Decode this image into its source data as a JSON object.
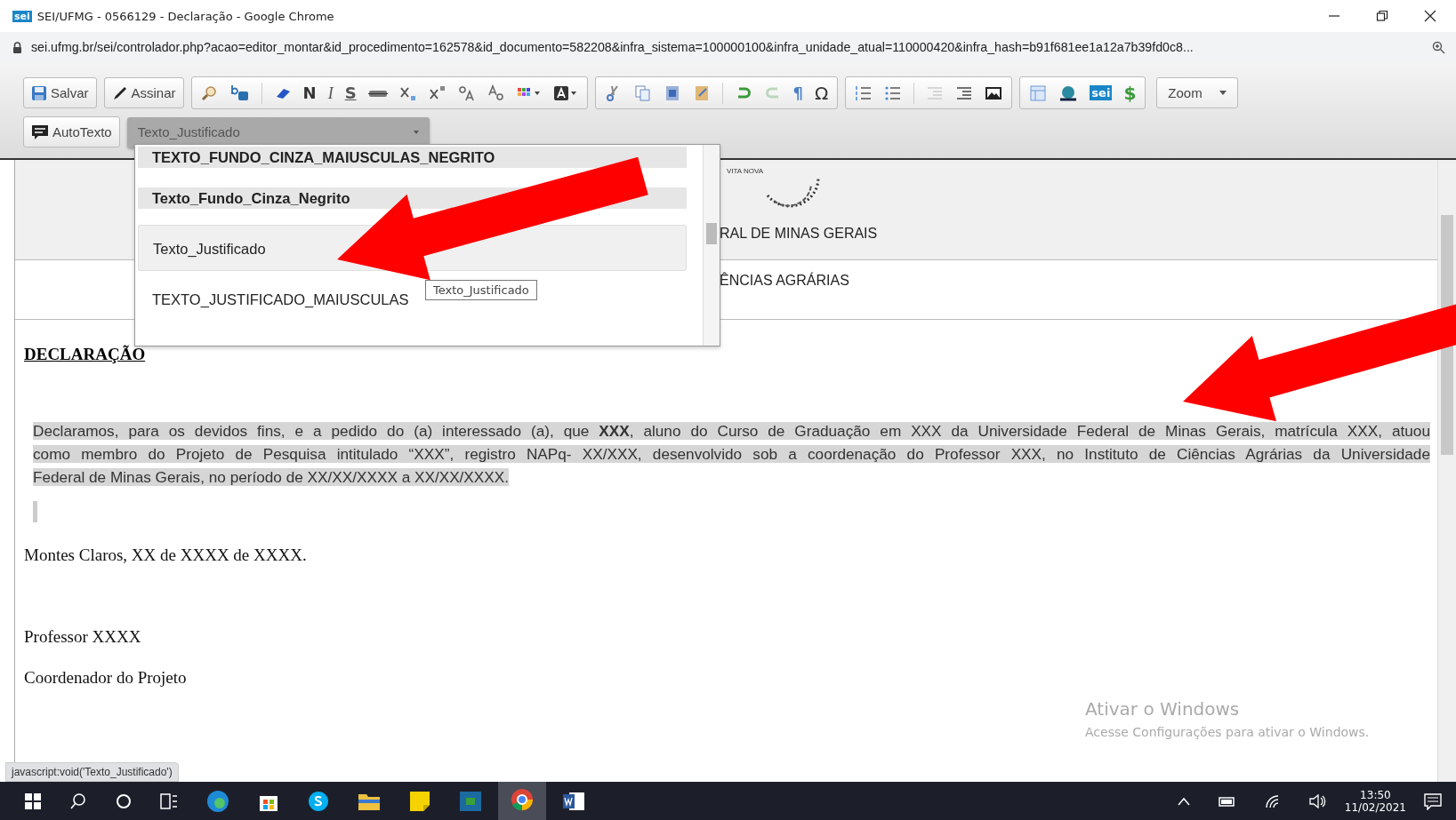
{
  "window": {
    "title": "SEI/UFMG - 0566129 - Declaração - Google Chrome",
    "logo": "sei"
  },
  "address_bar": {
    "url": "sei.ufmg.br/sei/controlador.php?acao=editor_montar&id_procedimento=162578&id_documento=582208&infra_sistema=100000100&infra_unidade_atual=110000420&infra_hash=b91f681ee1a12a7b39fd0c8..."
  },
  "toolbar": {
    "save_button": "Salvar",
    "sign_button": "Assinar",
    "bold": "N",
    "italic": "I",
    "strike": "S",
    "pilcrow": "¶",
    "omega": "Ω",
    "sei_logo": "sei",
    "dollar": "$",
    "zoom": "Zoom",
    "autotext_button": "AutoTexto",
    "style_select": "Texto_Justificado"
  },
  "style_dropdown": {
    "items": [
      {
        "label": "TEXTO_FUNDO_CINZA_MAIUSCULAS_NEGRITO",
        "kind": "bold-gray",
        "selected": false
      },
      {
        "label": "Texto_Fundo_Cinza_Negrito",
        "kind": "bold-gray",
        "selected": false
      },
      {
        "label": "Texto_Justificado",
        "kind": "plain",
        "selected": true
      },
      {
        "label": "TEXTO_JUSTIFICADO_MAIUSCULAS",
        "kind": "plain",
        "selected": false
      }
    ],
    "tooltip": "Texto_Justificado"
  },
  "document": {
    "seal_text": "VITA NOVA",
    "header_line_1": "RAL DE MINAS GERAIS",
    "header_line_2": "ÊNCIAS AGRÁRIAS",
    "title": "DECLARAÇÃO",
    "paragraph_lines": [
      "Declaramos, para os devidos fins, e a pedido do (a) interessado (a), que **XXX**, aluno do Curso de Graduação em XXX da Universidade Federal de Minas Gerais, matrícula XXX, atuou",
      "como membro do Projeto de Pesquisa intitulado “XXX”, registro NAPq- XX/XXX, desenvolvido sob a coordenação do Professor XXX, no Instituto de Ciências Agrárias da Universidade",
      "Federal de Minas Gerais, no período de XX/XX/XXXX a XX/XX/XXXX."
    ],
    "place_date": "Montes Claros, XX de XXXX de XXXX.",
    "signer_name": "Professor XXXX",
    "signer_role": "Coordenador do Projeto"
  },
  "status_url": "javascript:void('Texto_Justificado')",
  "windows_watermark": {
    "title": "Ativar o Windows",
    "subtitle": "Acesse Configurações para ativar o Windows."
  },
  "taskbar": {
    "time": "13:50",
    "date": "11/02/2021"
  }
}
